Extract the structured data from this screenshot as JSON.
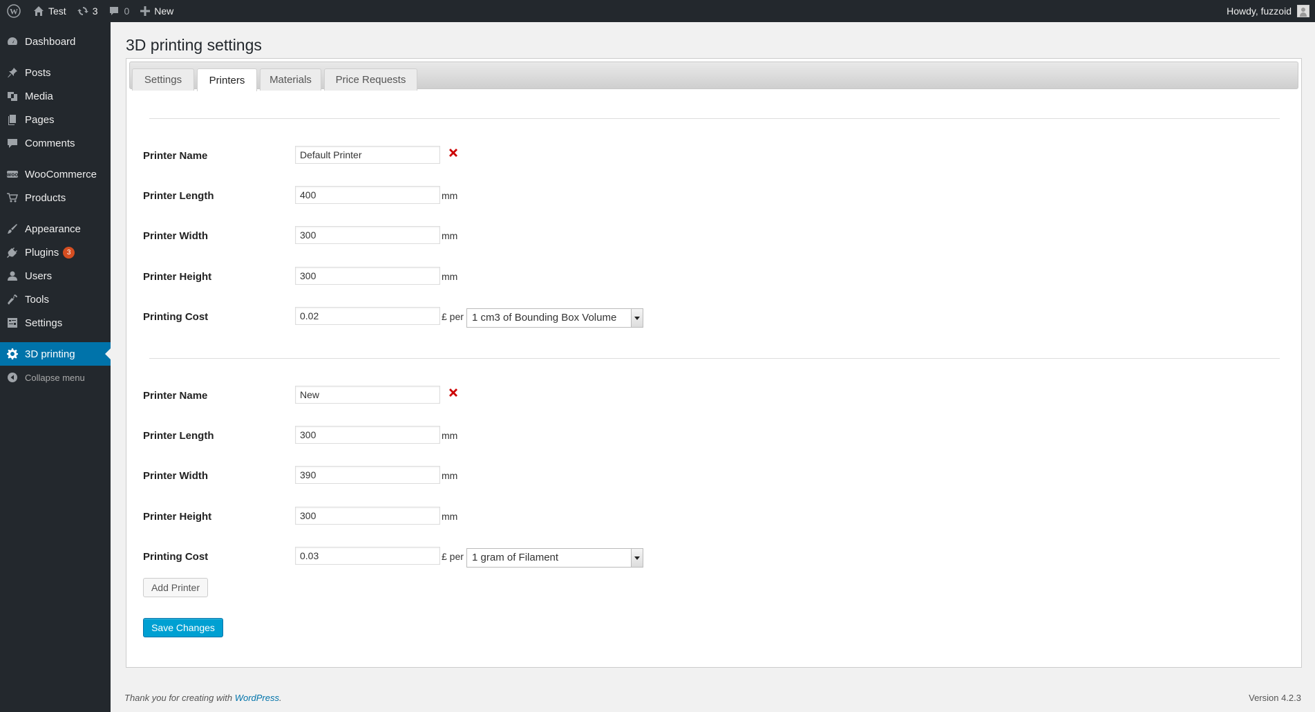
{
  "adminbar": {
    "site_name": "Test",
    "updates_count": "3",
    "comments_count": "0",
    "new_label": "New",
    "greeting": "Howdy, fuzzoid"
  },
  "menu": {
    "dashboard": "Dashboard",
    "posts": "Posts",
    "media": "Media",
    "pages": "Pages",
    "comments": "Comments",
    "woocommerce": "WooCommerce",
    "products": "Products",
    "appearance": "Appearance",
    "plugins": "Plugins",
    "plugins_badge": "3",
    "users": "Users",
    "tools": "Tools",
    "settings": "Settings",
    "printing3d": "3D printing",
    "collapse": "Collapse menu"
  },
  "page": {
    "title": "3D printing settings",
    "tabs": [
      "Settings",
      "Printers",
      "Materials",
      "Price Requests"
    ],
    "active_tab": "Printers"
  },
  "labels": {
    "printer_name": "Printer Name",
    "printer_length": "Printer Length",
    "printer_width": "Printer Width",
    "printer_height": "Printer Height",
    "printing_cost": "Printing Cost",
    "unit_mm": "mm",
    "per": "£ per"
  },
  "printers": [
    {
      "name": "Default Printer",
      "length": "400",
      "width": "300",
      "height": "300",
      "cost": "0.02",
      "cost_unit": "1 cm3 of Bounding Box Volume"
    },
    {
      "name": "New",
      "length": "300",
      "width": "390",
      "height": "300",
      "cost": "0.03",
      "cost_unit": "1 gram of Filament"
    }
  ],
  "buttons": {
    "add_printer": "Add Printer",
    "save_changes": "Save Changes"
  },
  "footer": {
    "thanks_prefix": "Thank you for creating with ",
    "thanks_link": "WordPress",
    "thanks_suffix": ".",
    "version": "Version 4.2.3"
  },
  "colors": {
    "adminbar_bg": "#23282d",
    "menu_current": "#0073aa",
    "primary_button": "#00a0d2",
    "delete_icon": "#cc0000"
  }
}
